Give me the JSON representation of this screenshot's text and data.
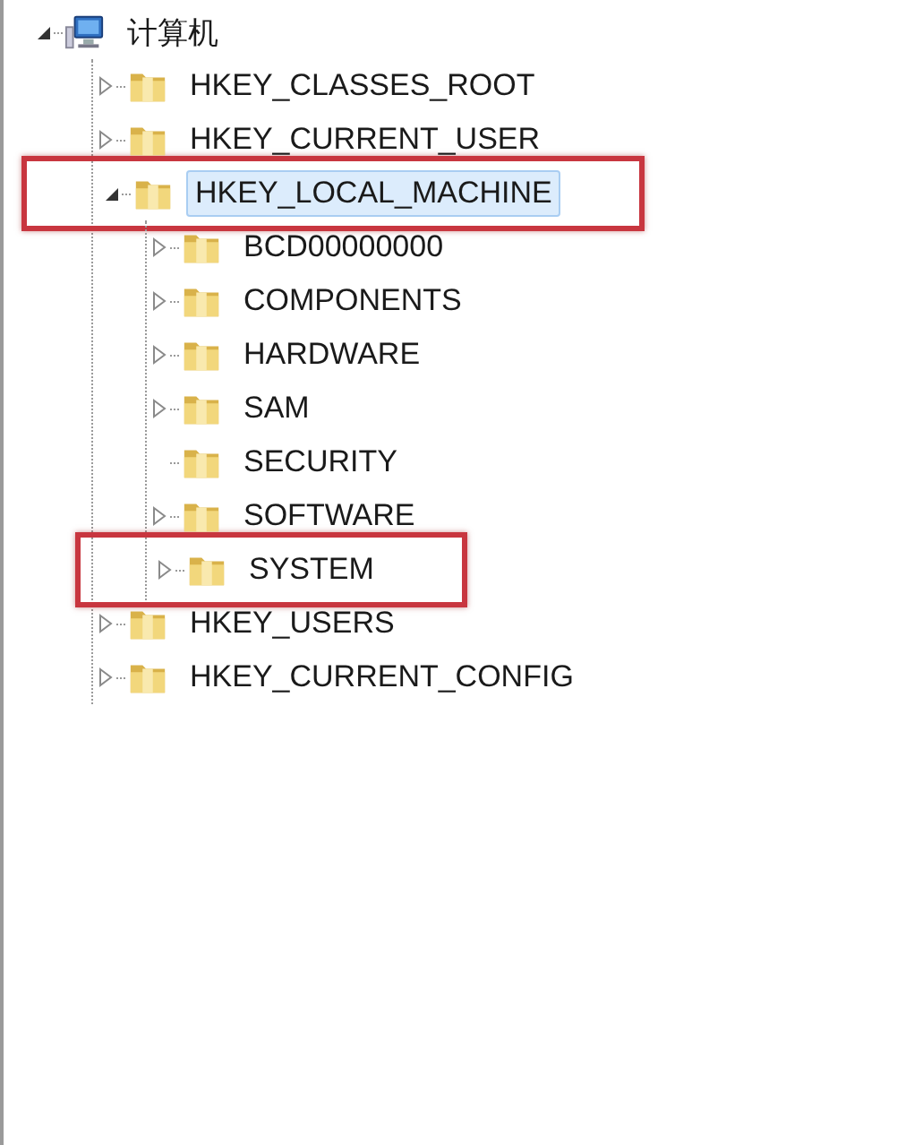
{
  "tree": [
    {
      "label": "计算机",
      "kind": "computer",
      "expandable": true,
      "expanded": true,
      "selected": false,
      "highlighted": false,
      "children": [
        {
          "label": "HKEY_CLASSES_ROOT",
          "kind": "folder",
          "expandable": true,
          "expanded": false,
          "selected": false,
          "highlighted": false
        },
        {
          "label": "HKEY_CURRENT_USER",
          "kind": "folder",
          "expandable": true,
          "expanded": false,
          "selected": false,
          "highlighted": false
        },
        {
          "label": "HKEY_LOCAL_MACHINE",
          "kind": "folder",
          "expandable": true,
          "expanded": true,
          "selected": true,
          "highlighted": true,
          "children": [
            {
              "label": "BCD00000000",
              "kind": "folder",
              "expandable": true,
              "expanded": false,
              "selected": false,
              "highlighted": false
            },
            {
              "label": "COMPONENTS",
              "kind": "folder",
              "expandable": true,
              "expanded": false,
              "selected": false,
              "highlighted": false
            },
            {
              "label": "HARDWARE",
              "kind": "folder",
              "expandable": true,
              "expanded": false,
              "selected": false,
              "highlighted": false
            },
            {
              "label": "SAM",
              "kind": "folder",
              "expandable": true,
              "expanded": false,
              "selected": false,
              "highlighted": false
            },
            {
              "label": "SECURITY",
              "kind": "folder",
              "expandable": false,
              "selected": false,
              "highlighted": false
            },
            {
              "label": "SOFTWARE",
              "kind": "folder",
              "expandable": true,
              "expanded": false,
              "selected": false,
              "highlighted": false
            },
            {
              "label": "SYSTEM",
              "kind": "folder",
              "expandable": true,
              "expanded": false,
              "selected": false,
              "highlighted": true
            }
          ]
        },
        {
          "label": "HKEY_USERS",
          "kind": "folder",
          "expandable": true,
          "expanded": false,
          "selected": false,
          "highlighted": false
        },
        {
          "label": "HKEY_CURRENT_CONFIG",
          "kind": "folder",
          "expandable": true,
          "expanded": false,
          "selected": false,
          "highlighted": false
        }
      ]
    }
  ]
}
